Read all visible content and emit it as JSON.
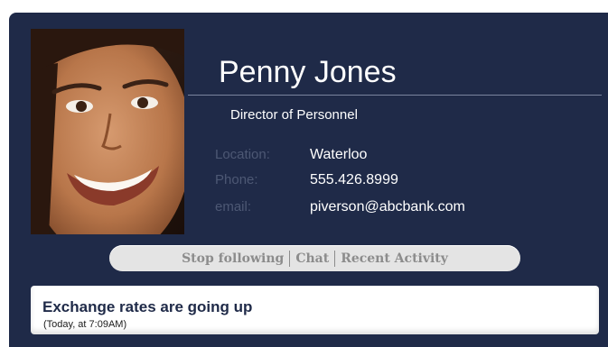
{
  "profile": {
    "name": "Penny Jones",
    "title": "Director of Personnel",
    "fields": {
      "location_label": "Location:",
      "location_value": "Waterloo",
      "phone_label": "Phone:",
      "phone_value": "555.426.8999",
      "email_label": "email:",
      "email_value": "piverson@abcbank.com"
    }
  },
  "actions": {
    "stop_following": "Stop following",
    "chat": "Chat",
    "recent_activity": "Recent Activity"
  },
  "status": {
    "text": "Exchange rates are going up",
    "time": "(Today, at 7:09AM)"
  },
  "colors": {
    "card_background": "#1f2a48",
    "label_color": "#4d5874",
    "action_bar": "#e4e4e4"
  }
}
